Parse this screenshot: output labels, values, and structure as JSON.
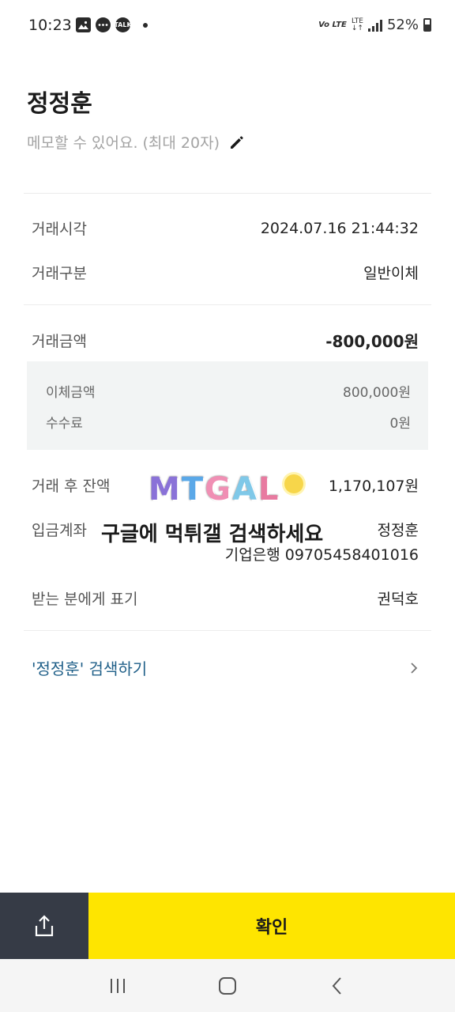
{
  "status_bar": {
    "time": "10:23",
    "network": "Vo LTE",
    "lte": "LTE",
    "battery": "52%",
    "left_icons": [
      "gallery-icon",
      "chat-icon",
      "kakaotalk-icon",
      "dot-icon"
    ],
    "kakaotalk_label": "TALK"
  },
  "header": {
    "payee_name": "정정훈",
    "memo_placeholder": "메모할 수 있어요. (최대 20자)"
  },
  "details": {
    "time_label": "거래시각",
    "time_value": "2024.07.16 21:44:32",
    "type_label": "거래구분",
    "type_value": "일반이체",
    "amount_label": "거래금액",
    "amount_value": "-800,000원",
    "transfer_label": "이체금액",
    "transfer_value": "800,000원",
    "fee_label": "수수료",
    "fee_value": "0원",
    "balance_label": "거래 후 잔액",
    "balance_value": "1,170,107원",
    "deposit_label": "입금계좌",
    "deposit_name": "정정훈",
    "deposit_account": "기업은행 09705458401016",
    "recipient_label": "받는 분에게 표기",
    "recipient_value": "권덕호"
  },
  "watermark": {
    "logo": "MTGAL",
    "text": "구글에 먹튀갤 검색하세요"
  },
  "search": {
    "label": "'정정훈' 검색하기"
  },
  "actions": {
    "confirm_label": "확인"
  },
  "colors": {
    "confirm_bg": "#fee500",
    "share_bg": "#363b46",
    "link": "#1f5f88"
  }
}
